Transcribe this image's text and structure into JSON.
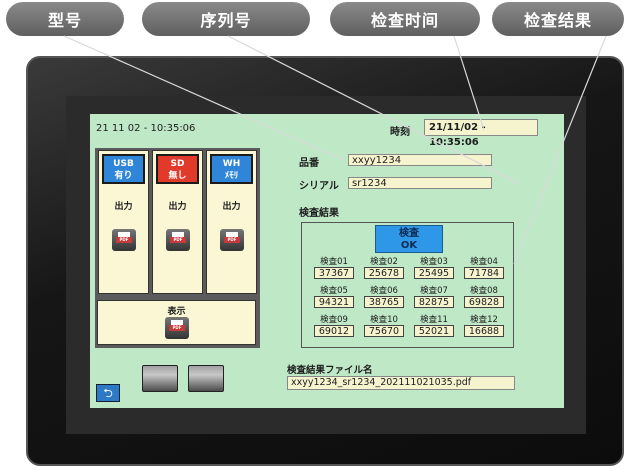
{
  "callouts": [
    "型号",
    "序列号",
    "检查时间",
    "检查结果"
  ],
  "screen": {
    "datetime_top": "21 11 02 - 10:35:06",
    "time_label": "時刻",
    "time_value": "21/11/02 - 10:35:06",
    "columns": [
      {
        "head_line1": "USB",
        "head_line2": "有り",
        "color": "#2f85d8",
        "out_label": "出力"
      },
      {
        "head_line1": "SD",
        "head_line2": "無し",
        "color": "#e23a2a",
        "out_label": "出力"
      },
      {
        "head_line1": "WH",
        "head_line2": "ﾒﾓﾘ",
        "color": "#2f85d8",
        "out_label": "出力"
      }
    ],
    "pdf_tag": "PDF",
    "show_label": "表示",
    "part_label": "品番",
    "part_value": "xxyy1234",
    "serial_label": "シリアル",
    "serial_value": "sr1234",
    "results_title": "検査結果",
    "result_line1": "検査",
    "result_line2": "OK",
    "results": [
      {
        "label": "検査01",
        "value": "37367"
      },
      {
        "label": "検査02",
        "value": "25678"
      },
      {
        "label": "検査03",
        "value": "25495"
      },
      {
        "label": "検査04",
        "value": "71784"
      },
      {
        "label": "検査05",
        "value": "94321"
      },
      {
        "label": "検査06",
        "value": "38765"
      },
      {
        "label": "検査07",
        "value": "82875"
      },
      {
        "label": "検査08",
        "value": "69828"
      },
      {
        "label": "検査09",
        "value": "69012"
      },
      {
        "label": "検査10",
        "value": "75670"
      },
      {
        "label": "検査11",
        "value": "52021"
      },
      {
        "label": "検査12",
        "value": "16688"
      }
    ],
    "file_label": "検査結果ファイル名",
    "file_value": "xxyy1234_sr1234_202111021035.pdf",
    "back_symbol": "⮌"
  }
}
